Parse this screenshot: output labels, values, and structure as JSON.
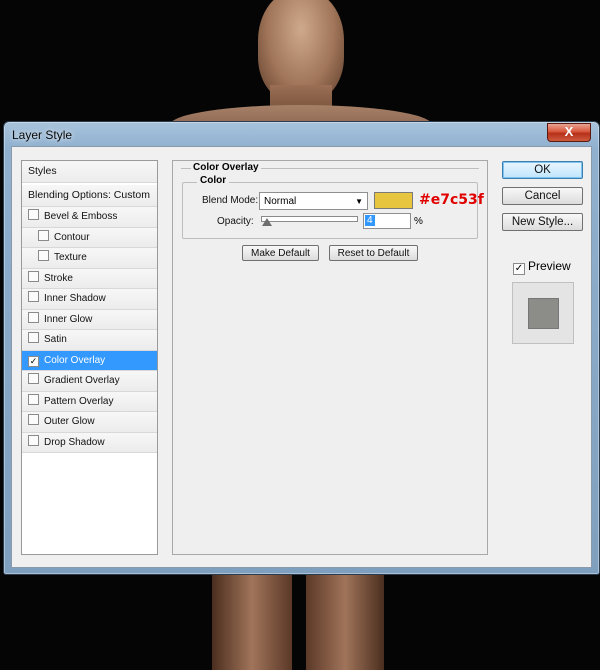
{
  "dialog": {
    "title": "Layer Style",
    "close_label": "X"
  },
  "style_list": {
    "styles_header": "Styles",
    "blending_header": "Blending Options: Custom",
    "items": [
      {
        "label": "Bevel & Emboss",
        "checked": false,
        "sub": false,
        "selected": false
      },
      {
        "label": "Contour",
        "checked": false,
        "sub": true,
        "selected": false
      },
      {
        "label": "Texture",
        "checked": false,
        "sub": true,
        "selected": false
      },
      {
        "label": "Stroke",
        "checked": false,
        "sub": false,
        "selected": false
      },
      {
        "label": "Inner Shadow",
        "checked": false,
        "sub": false,
        "selected": false
      },
      {
        "label": "Inner Glow",
        "checked": false,
        "sub": false,
        "selected": false
      },
      {
        "label": "Satin",
        "checked": false,
        "sub": false,
        "selected": false
      },
      {
        "label": "Color Overlay",
        "checked": true,
        "sub": false,
        "selected": true
      },
      {
        "label": "Gradient Overlay",
        "checked": false,
        "sub": false,
        "selected": false
      },
      {
        "label": "Pattern Overlay",
        "checked": false,
        "sub": false,
        "selected": false
      },
      {
        "label": "Outer Glow",
        "checked": false,
        "sub": false,
        "selected": false
      },
      {
        "label": "Drop Shadow",
        "checked": false,
        "sub": false,
        "selected": false
      }
    ]
  },
  "color_overlay": {
    "group_title": "Color Overlay",
    "fieldset_title": "Color",
    "blend_mode_label": "Blend Mode:",
    "blend_mode_value": "Normal",
    "swatch_color": "#e7c53f",
    "hex_annotation": "#e7c53f",
    "opacity_label": "Opacity:",
    "opacity_value": "4",
    "opacity_unit": "%",
    "opacity_fraction": 0.04,
    "make_default_label": "Make Default",
    "reset_default_label": "Reset to Default"
  },
  "actions": {
    "ok_label": "OK",
    "cancel_label": "Cancel",
    "new_style_label": "New Style...",
    "preview_label": "Preview",
    "preview_checked": true
  }
}
